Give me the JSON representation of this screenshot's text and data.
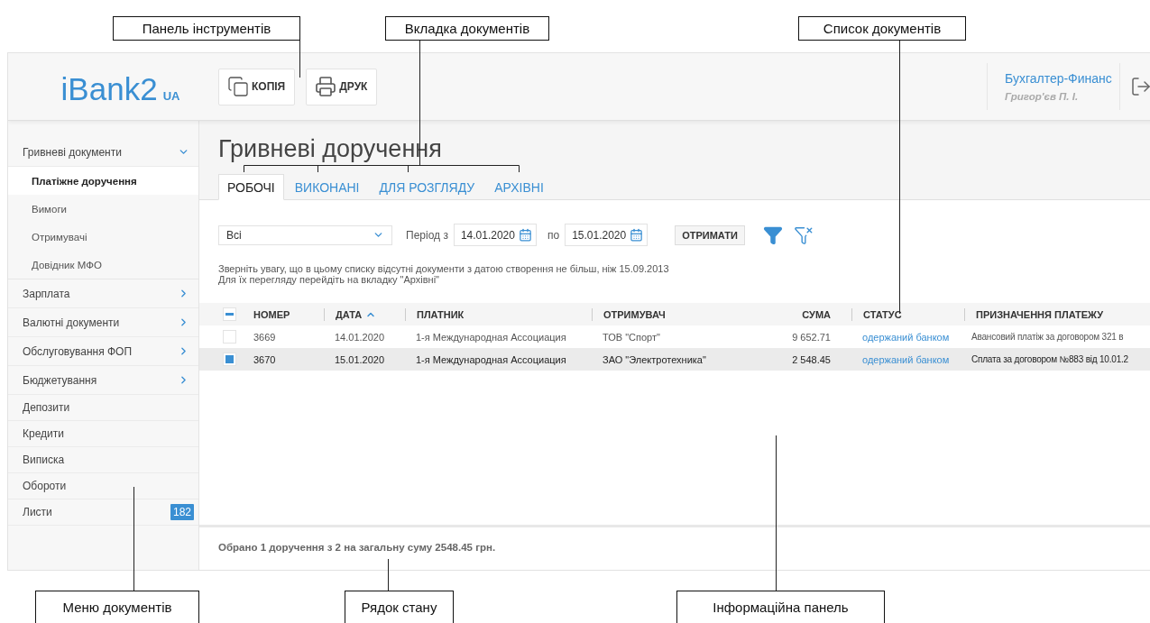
{
  "callouts_top": [
    "Панель інструментів",
    "Вкладка документів",
    "Список документів"
  ],
  "header": {
    "logo": "iBank2",
    "logo_suffix": "UA",
    "toolbar": [
      {
        "kind": "copy",
        "label": "КОПІЯ"
      },
      {
        "kind": "print",
        "label": "ДРУК"
      }
    ],
    "organization": "Бухгалтер-Финанс",
    "user": "Григор'єв П. І."
  },
  "sidebar": {
    "items": [
      {
        "kind": "group",
        "label": "Гривневі документи",
        "expanded": true,
        "children": [
          {
            "label": "Платіжне доручення",
            "selected": true
          },
          {
            "label": "Вимоги",
            "selected": false
          },
          {
            "label": "Отримувачі",
            "selected": false
          },
          {
            "label": "Довідник МФО",
            "selected": false
          }
        ]
      },
      {
        "kind": "group",
        "label": "Зарплата",
        "expanded": false
      },
      {
        "kind": "group",
        "label": "Валютні документи",
        "expanded": false
      },
      {
        "kind": "group",
        "label": "Обслуговування ФОП",
        "expanded": false
      },
      {
        "kind": "group",
        "label": "Бюджетування",
        "expanded": false
      },
      {
        "kind": "link",
        "label": "Депозити"
      },
      {
        "kind": "link",
        "label": "Кредити"
      },
      {
        "kind": "link",
        "label": "Виписка"
      },
      {
        "kind": "link",
        "label": "Обороти"
      },
      {
        "kind": "link",
        "label": "Листи",
        "badge": "182"
      }
    ]
  },
  "page": {
    "title": "Гривневі доручення",
    "tabs": [
      {
        "label": "РОБОЧІ",
        "selected": true
      },
      {
        "label": "ВИКОНАНІ",
        "selected": false
      },
      {
        "label": "ДЛЯ РОЗГЛЯДУ",
        "selected": false
      },
      {
        "label": "АРХІВНІ",
        "selected": false
      }
    ]
  },
  "filter": {
    "type_select": "Всі",
    "period_label": "Період з",
    "date_from": "14.01.2020",
    "to_label": "по",
    "date_to": "15.01.2020",
    "get_button": "ОТРИМАТИ"
  },
  "notice": [
    "Зверніть увагу, що в цьому списку відсутні документи з датою створення не більш, ніж 15.09.2013",
    "Для їх перегляду перейдіть на вкладку \"Архівні\""
  ],
  "table": {
    "select_all_indeterminate": true,
    "columns": [
      {
        "label": "НОМЕР"
      },
      {
        "label": "ДАТА",
        "sorted": true
      },
      {
        "label": "ПЛАТНИК"
      },
      {
        "label": "ОТРИМУВАЧ"
      },
      {
        "label": "СУМА"
      },
      {
        "label": "СТАТУС"
      },
      {
        "label": "ПРИЗНАЧЕННЯ ПЛАТЕЖУ"
      }
    ],
    "rows": [
      {
        "checked": false,
        "selected": false,
        "cells": [
          "3669",
          "14.01.2020",
          "1-я Международная Ассоциация",
          "ТОВ \"Спорт\"",
          "9 652.71",
          "одержаний банком",
          "Авансовий платіж за договором 321 в"
        ]
      },
      {
        "checked": true,
        "selected": true,
        "cells": [
          "3670",
          "15.01.2020",
          "1-я Международная Ассоциация",
          "ЗАО \"Электротехника\"",
          "2 548.45",
          "одержаний банком",
          "Сплата за договором №883 від 10.01.2"
        ]
      }
    ]
  },
  "status_bar": "Обрано 1 доручення з 2 на загальну суму 2548.45 грн.",
  "callouts_bottom": [
    "Меню документів",
    "Рядок стану",
    "Інформаційна панель"
  ]
}
